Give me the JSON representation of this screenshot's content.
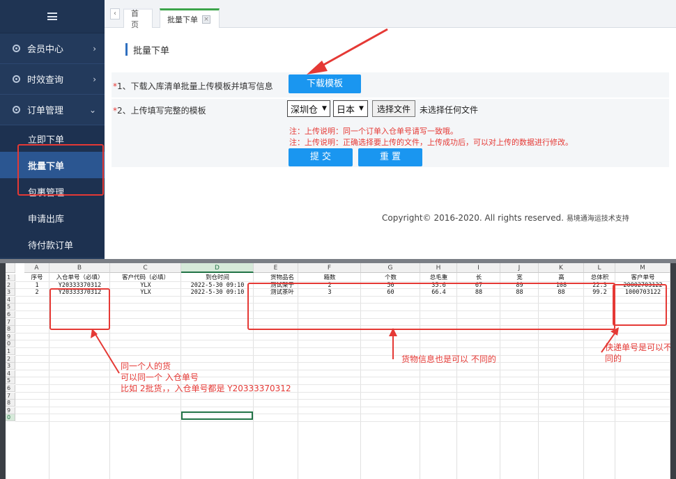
{
  "sidebar": {
    "items": [
      {
        "label": "会员中心",
        "chevron": "›"
      },
      {
        "label": "时效查询",
        "chevron": "›"
      },
      {
        "label": "订单管理",
        "chevron": "⌄"
      }
    ],
    "subitems": [
      "立即下单",
      "批量下单",
      "包裹管理",
      "申请出库",
      "待付款订单"
    ]
  },
  "tabs": {
    "nav": "‹",
    "home": "首页",
    "active": "批量下单",
    "close": "×"
  },
  "panel": {
    "title": "批量下单",
    "step1_star": "*",
    "step1_label": "1、下载入库清单批量上传模板并填写信息",
    "download_button": "下载模板",
    "step2_star": "*",
    "step2_label": "2、上传填写完整的模板",
    "warehouse_select": "深圳仓",
    "country_select": "日本",
    "file_button": "选择文件",
    "file_status": "未选择任何文件",
    "note1": "注：上传说明：同一个订单入仓单号请写一致哦。",
    "note2": "注：上传说明：正确选择要上传的文件，上传成功后，可以对上传的数据进行修改。",
    "submit_button": "提 交",
    "reset_button": "重 置"
  },
  "footer": {
    "copyright": "Copyright© 2016-2020. All rights reserved.",
    "support": "易境通海运技术支持"
  },
  "sheet": {
    "columns": [
      "A",
      "B",
      "C",
      "D",
      "E",
      "F",
      "G",
      "H",
      "I",
      "J",
      "K",
      "L",
      "M"
    ],
    "header_row": [
      "序号",
      "入仓单号（必填）",
      "客户代码（必填）",
      "到仓时间",
      "货物品名",
      "箱数",
      "个数",
      "总毛重",
      "长",
      "宽",
      "高",
      "总体积",
      "客户单号"
    ],
    "rows": [
      [
        "1",
        "Y20333370312",
        "YLX",
        "2022-5-30 09:10",
        "测试架子",
        "2",
        "50",
        "35.6",
        "67",
        "89",
        "108",
        "22.3",
        "20002703122"
      ],
      [
        "2",
        "Y20333370312",
        "YLX",
        "2022-5-30 09:10",
        "测试茶叶",
        "3",
        "60",
        "66.4",
        "88",
        "88",
        "88",
        "99.2",
        "1000703122"
      ]
    ],
    "row_numbers": [
      "1",
      "2",
      "3",
      "4",
      "5",
      "6",
      "7",
      "8",
      "9",
      "0",
      "1",
      "2",
      "3",
      "4",
      "5",
      "6",
      "7",
      "8",
      "9",
      "0"
    ]
  },
  "annotations": {
    "a1_line1": "同一个人的货",
    "a1_line2": "可以同一个 入仓单号",
    "a1_line3": "比如 2批货，，入仓单号都是 Y20333370312",
    "a2": "货物信息也是可以 不同的",
    "a3_line1": "快递单号是可以不",
    "a3_line2": "同的"
  },
  "colors": {
    "sidebar": "#233a5c",
    "accent_blue": "#1a96f0",
    "annotation_red": "#e53935",
    "excel_green": "#217346"
  }
}
